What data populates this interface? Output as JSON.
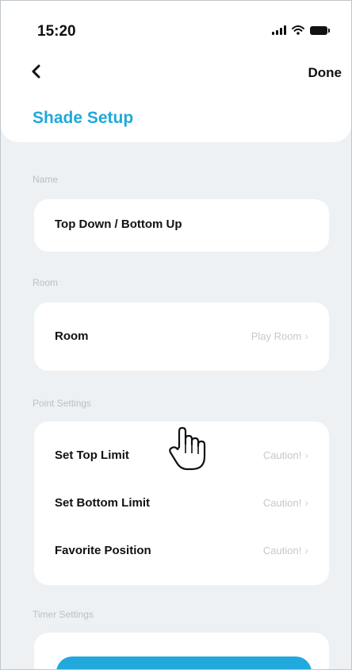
{
  "status_bar": {
    "time": "15:20",
    "icons": [
      "signal-icon",
      "wifi-icon",
      "battery-icon"
    ]
  },
  "header": {
    "back_icon": "chevron-left-icon",
    "done_label": "Done",
    "title": "Shade Setup"
  },
  "sections": {
    "name": {
      "label": "Name",
      "value": "Top Down / Bottom Up"
    },
    "room": {
      "label": "Room",
      "row_label": "Room",
      "row_value": "Play Room"
    },
    "point_settings": {
      "label": "Point Settings",
      "rows": [
        {
          "label": "Set Top Limit",
          "value": "Caution!"
        },
        {
          "label": "Set Bottom Limit",
          "value": "Caution!"
        },
        {
          "label": "Favorite Position",
          "value": "Caution!"
        }
      ]
    },
    "timer_settings": {
      "label": "Timer Settings"
    }
  },
  "colors": {
    "accent": "#21a8dc",
    "background": "#eef1f3",
    "card": "#ffffff",
    "muted_text": "#b9c0c6"
  }
}
